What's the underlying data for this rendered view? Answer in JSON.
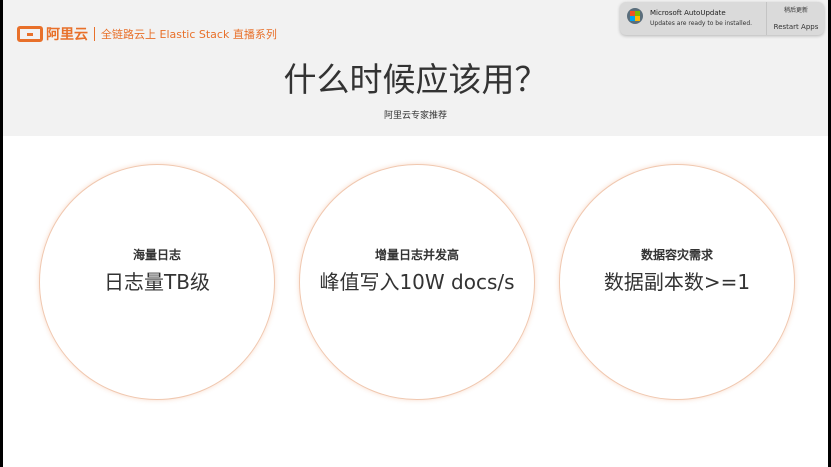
{
  "brand": {
    "logo_text": "阿里云",
    "series": "全链路云上 Elastic Stack 直播系列",
    "accent": "#e8702a"
  },
  "slide": {
    "title": "什么时候应该用？",
    "subtitle": "阿里云专家推荐",
    "circles": [
      {
        "label": "海量日志",
        "value": "日志量TB级"
      },
      {
        "label": "增量日志并发高",
        "value": "峰值写入10W docs/s"
      },
      {
        "label": "数据容灾需求",
        "value": "数据副本数>=1"
      }
    ]
  },
  "notification": {
    "app_name": "Microsoft AutoUpdate",
    "message": "Updates are ready to be installed.",
    "later_button": "稍后更新",
    "restart_button": "Restart Apps",
    "icon": "microsoft-autoupdate-icon"
  }
}
